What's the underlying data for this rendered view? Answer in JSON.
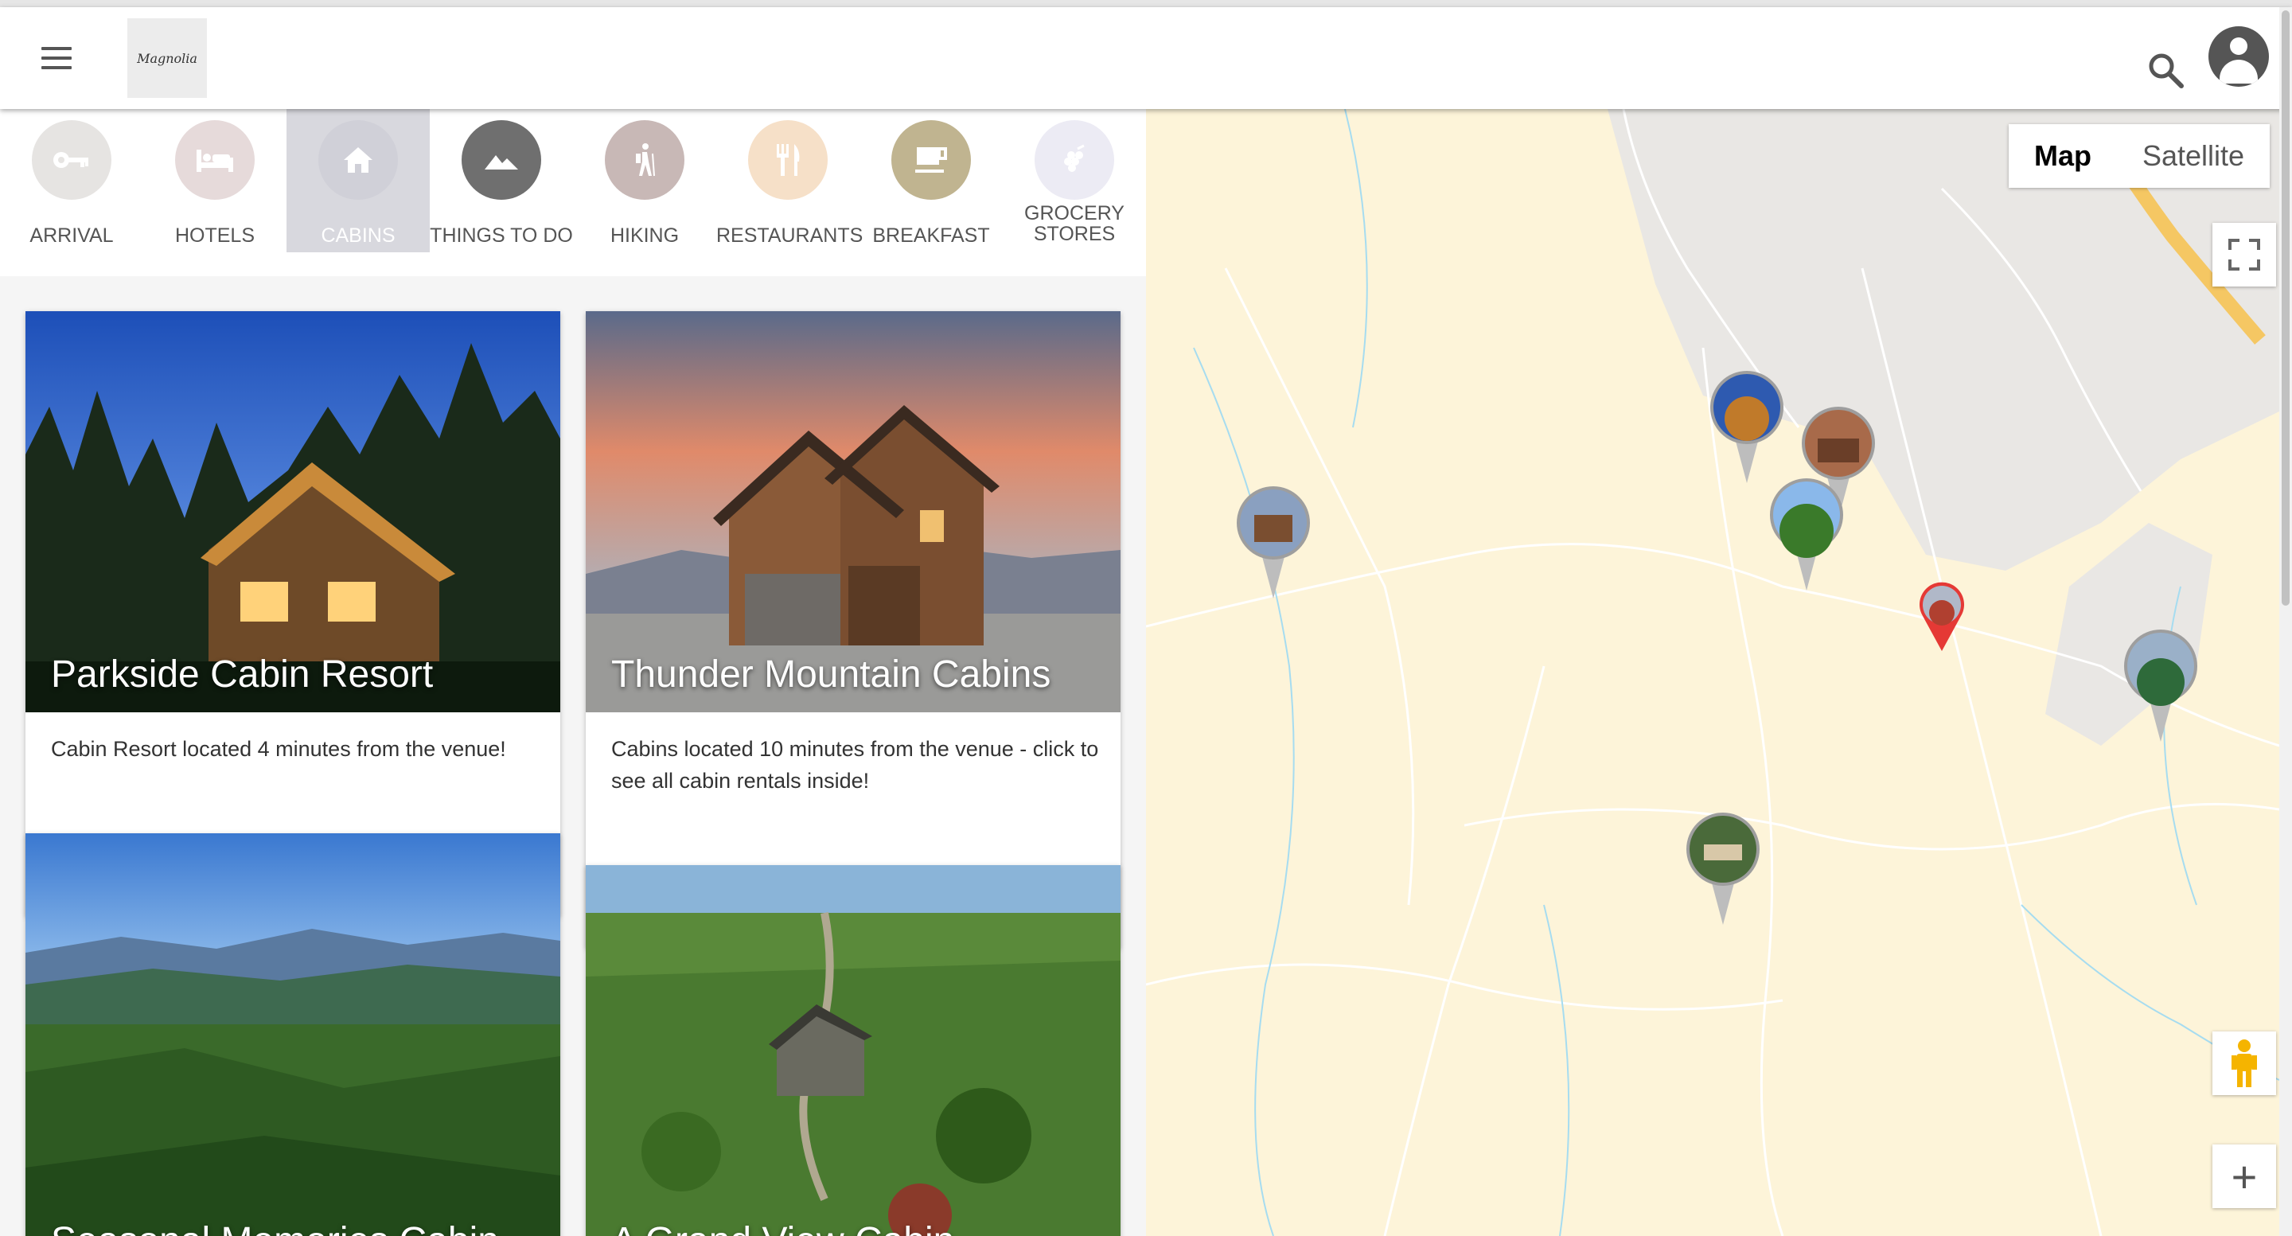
{
  "header": {
    "logo_text": "Magnolia"
  },
  "categories": [
    {
      "label": "ARRIVAL",
      "icon": "key-icon",
      "color": "#e6e4e2"
    },
    {
      "label": "HOTELS",
      "icon": "bed-icon",
      "color": "#e6dada"
    },
    {
      "label": "CABINS",
      "icon": "home-icon",
      "color": "#d0d0d8",
      "active": true
    },
    {
      "label": "THINGS TO DO",
      "icon": "mountain-icon",
      "color": "#6f6f6f"
    },
    {
      "label": "HIKING",
      "icon": "hiker-icon",
      "color": "#c8b8b6"
    },
    {
      "label": "RESTAURANTS",
      "icon": "utensils-icon",
      "color": "#f6e0c8"
    },
    {
      "label": "BREAKFAST",
      "icon": "coffee-icon",
      "color": "#c0b490"
    },
    {
      "label": "GROCERY STORES",
      "icon": "grapes-icon",
      "color": "#ecebf4"
    }
  ],
  "cards": [
    {
      "title": "Parkside Cabin Resort",
      "description": "Cabin Resort located 4 minutes from the venue!"
    },
    {
      "title": "Thunder Mountain Cabins",
      "description": "Cabins located 10 minutes from the venue - click to see all cabin rentals inside!"
    },
    {
      "title": "Seasonal Memories Cabin",
      "description": ""
    },
    {
      "title": "A Grand View Cabin",
      "description": ""
    }
  ],
  "map": {
    "toggle_map": "Map",
    "toggle_satellite": "Satellite",
    "zoom_in": "+"
  }
}
